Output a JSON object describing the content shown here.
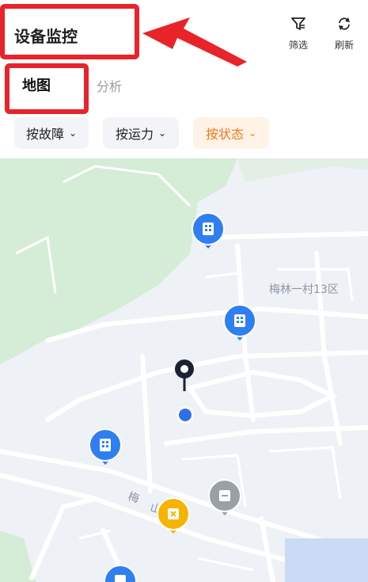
{
  "header": {
    "title": "设备监控",
    "actions": [
      {
        "label": "筛选",
        "icon": "filter-icon"
      },
      {
        "label": "刷新",
        "icon": "refresh-icon"
      }
    ]
  },
  "tabs": [
    {
      "label": "地图",
      "active": true
    },
    {
      "label": "分析",
      "active": false
    }
  ],
  "filters": [
    {
      "label": "按故障",
      "active": false
    },
    {
      "label": "按运力",
      "active": false
    },
    {
      "label": "按状态",
      "active": true
    }
  ],
  "map": {
    "place_label": "梅林一村13区",
    "road_label_1": "梅",
    "road_label_2": "山"
  },
  "colors": {
    "accent_orange": "#f07b1c",
    "marker_blue": "#2f7ff0",
    "marker_yellow": "#f5b400",
    "marker_gray": "#9aa0a8",
    "highlight_red": "#e8232a"
  }
}
